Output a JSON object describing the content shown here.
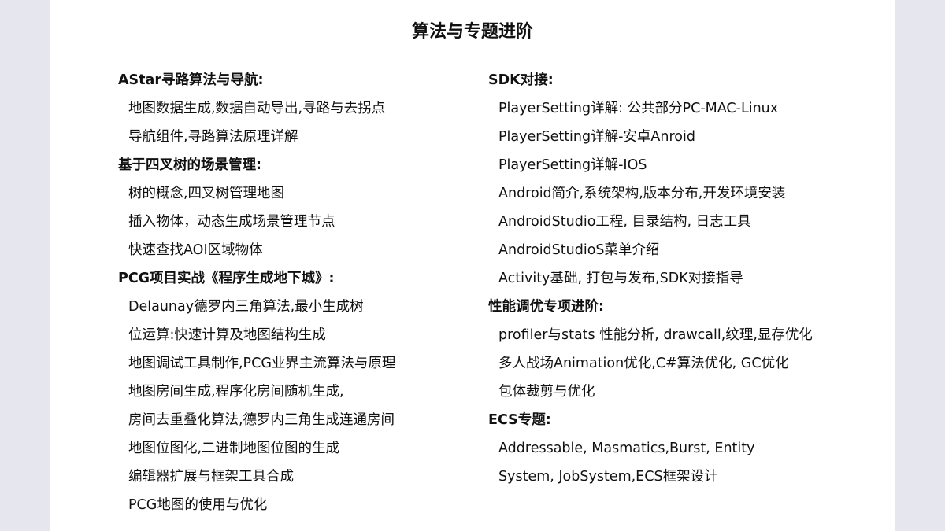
{
  "title": "算法与专题进阶",
  "left_column": [
    {
      "kind": "heading",
      "text": "AStar寻路算法与导航:"
    },
    {
      "kind": "item",
      "text": "地图数据生成,数据自动导出,寻路与去拐点"
    },
    {
      "kind": "item",
      "text": "导航组件,寻路算法原理详解"
    },
    {
      "kind": "heading",
      "text": "基于四叉树的场景管理:"
    },
    {
      "kind": "item",
      "text": "树的概念,四叉树管理地图"
    },
    {
      "kind": "item",
      "text": "插入物体，动态生成场景管理节点"
    },
    {
      "kind": "item",
      "text": "快速查找AOI区域物体"
    },
    {
      "kind": "heading",
      "text": "PCG项目实战《程序生成地下城》:"
    },
    {
      "kind": "item",
      "text": "Delaunay德罗内三角算法,最小生成树"
    },
    {
      "kind": "item",
      "text": "位运算:快速计算及地图结构生成"
    },
    {
      "kind": "item",
      "text": "地图调试工具制作,PCG业界主流算法与原理"
    },
    {
      "kind": "item",
      "text": "地图房间生成,程序化房间随机生成,"
    },
    {
      "kind": "item",
      "text": "房间去重叠化算法,德罗内三角生成连通房间"
    },
    {
      "kind": "item",
      "text": "地图位图化,二进制地图位图的生成"
    },
    {
      "kind": "item",
      "text": "编辑器扩展与框架工具合成"
    },
    {
      "kind": "item",
      "text": "PCG地图的使用与优化"
    }
  ],
  "right_column": [
    {
      "kind": "heading",
      "text": "SDK对接:"
    },
    {
      "kind": "item",
      "text": "PlayerSetting详解: 公共部分PC-MAC-Linux"
    },
    {
      "kind": "item",
      "text": "PlayerSetting详解-安卓Anroid"
    },
    {
      "kind": "item",
      "text": "PlayerSetting详解-IOS"
    },
    {
      "kind": "item",
      "text": "Android简介,系统架构,版本分布,开发环境安装"
    },
    {
      "kind": "item",
      "text": "AndroidStudio工程, 目录结构, 日志工具"
    },
    {
      "kind": "item",
      "text": "AndroidStudioS菜单介绍"
    },
    {
      "kind": "item",
      "text": "Activity基础, 打包与发布,SDK对接指导"
    },
    {
      "kind": "heading",
      "text": "性能调优专项进阶:"
    },
    {
      "kind": "item",
      "text": "profiler与stats 性能分析, drawcall,纹理,显存优化"
    },
    {
      "kind": "item",
      "text": "多人战场Animation优化,C#算法优化, GC优化"
    },
    {
      "kind": "item",
      "text": "包体裁剪与优化"
    },
    {
      "kind": "heading",
      "text": "ECS专题:"
    },
    {
      "kind": "item",
      "text": "Addressable, Masmatics,Burst, Entity"
    },
    {
      "kind": "item",
      "text": "System, JobSystem,ECS框架设计"
    }
  ]
}
